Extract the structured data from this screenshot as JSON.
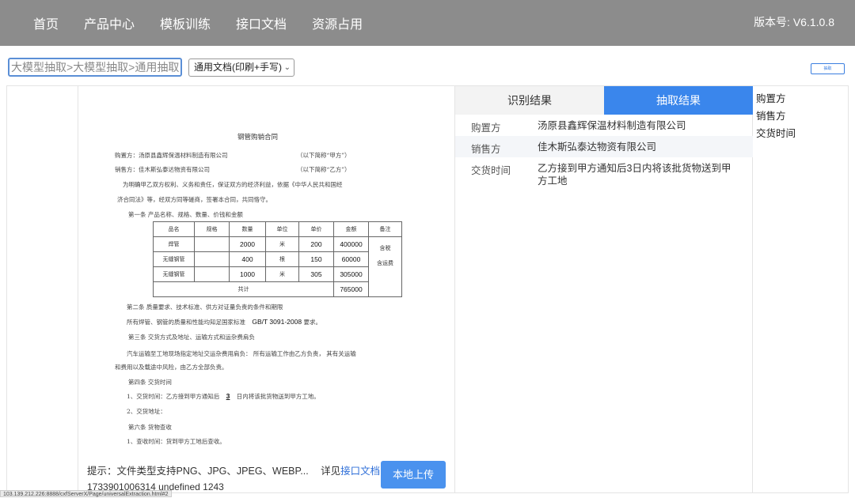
{
  "nav": {
    "items": [
      "首页",
      "产品中心",
      "模板训练",
      "接口文档",
      "资源占用"
    ],
    "version": "版本号: V6.1.0.8"
  },
  "toolbar": {
    "breadcrumb": "大模型抽取>大模型抽取>通用抽取",
    "doc_type": "通用文档(印刷+手写)",
    "extract_label": "抽取"
  },
  "document": {
    "title": "钢管购销合同",
    "buyer_line": "购置方：汤原县鑫辉保温材料制造有限公司",
    "buyer_abbr": "（以下简称“甲方”）",
    "seller_line": "销售方：佳木斯弘泰达物资有限公司",
    "seller_abbr": "（以下简称“乙方”）",
    "intro1": "为明确甲乙双方权利、义务和责任，保证双方的经济利益，依据《中华人民共和国经",
    "intro2": "济合同法》等，经双方同等磋商，签署本合同，共同恪守。",
    "art1": "第一条  产品名称、规格、数量、价钱和金额",
    "table": {
      "header": [
        "品名",
        "规格",
        "数量",
        "单位",
        "单价",
        "金额",
        "备注"
      ],
      "rows": [
        [
          "焊管",
          "",
          "2000",
          "米",
          "200",
          "400000"
        ],
        [
          "无缝钢管",
          "",
          "400",
          "根",
          "150",
          "60000"
        ],
        [
          "无缝钢管",
          "",
          "1000",
          "米",
          "305",
          "305000"
        ]
      ],
      "note": [
        "含税",
        "含运费"
      ],
      "total_label": "共计",
      "total": "765000"
    },
    "art2": "第二条  质量要求、技术标准、供方对证量负责的条件和期限",
    "art2_text": "所有焊管、钢管的质量和性能均知足国家标准",
    "art2_std": "GB/T 3091-2008",
    "art2_tail": "要求。",
    "art3": "第三条  交货方式及地址、运输方式和运杂费肩负",
    "art3_text1": "汽车运输至工地现场指定地址交运杂费用肩负：  所有运输工作由乙方负责，  其有关运输",
    "art3_text2": "和费用以及载途中风险，由乙方全部负责。",
    "art4": "第四条  交货时间",
    "art4_1a": "1、交货时间：乙方接到甲方通知后",
    "art4_1n": "3",
    "art4_1b": "日内将该批货物送到甲方工地。",
    "art4_2": "2、交货地址：",
    "art6": "第六条  货物查收",
    "art6_1": "1、查收时间：货到甲方工地后查收。"
  },
  "tip": {
    "text": "提示：文件类型支持PNG、JPG、JPEG、WEBP...",
    "see": "详见",
    "link": "接口文档",
    "debug": "1733901006314  undefined  1243",
    "upload": "本地上传"
  },
  "result": {
    "tabs": [
      "识别结果",
      "抽取结果"
    ],
    "rows": [
      {
        "key": "购置方",
        "value": "汤原县鑫辉保温材料制造有限公司"
      },
      {
        "key": "销售方",
        "value": "佳木斯弘泰达物资有限公司"
      },
      {
        "key": "交货时间",
        "value": "乙方接到甲方通知后3日内将该批货物送到甲方工地"
      }
    ]
  },
  "fields": [
    "购置方",
    "销售方",
    "交货时间"
  ],
  "status_url": "103.139.212.226:8888/cxfServerX/Page/universalExtraction.html#2",
  "colors": {
    "nav_bg": "#8c8c8c",
    "accent": "#3a86ec",
    "link": "#2f6fd8"
  }
}
